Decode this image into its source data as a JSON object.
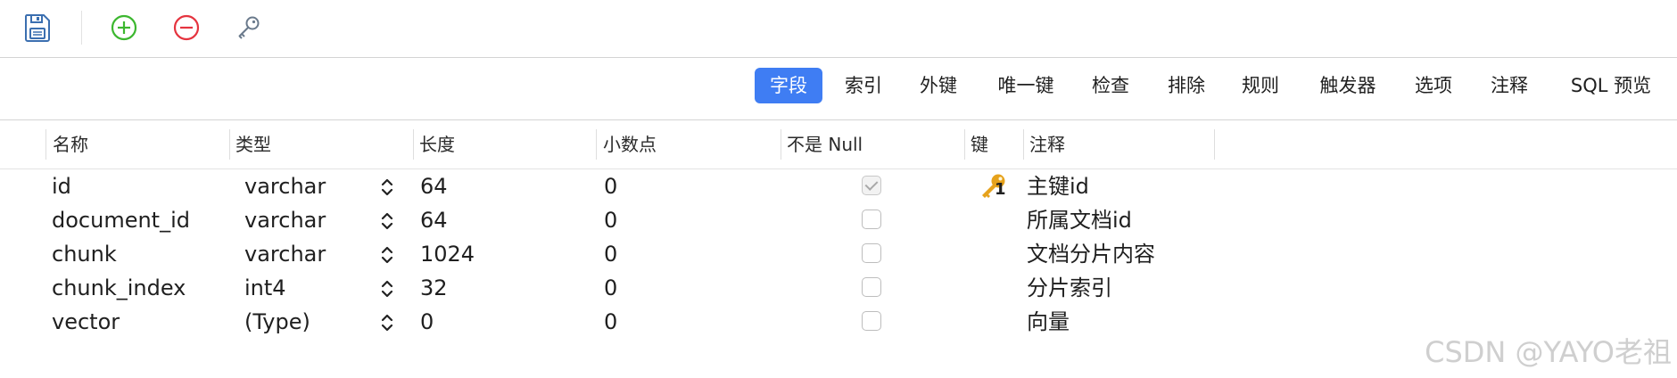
{
  "toolbar": {
    "icons": [
      "save-icon",
      "plus-circle-icon",
      "minus-circle-icon",
      "key-icon"
    ]
  },
  "tabs": [
    {
      "label": "字段",
      "active": true
    },
    {
      "label": "索引"
    },
    {
      "label": "外键"
    },
    {
      "label": "唯一键"
    },
    {
      "label": "检查"
    },
    {
      "label": "排除"
    },
    {
      "label": "规则"
    },
    {
      "label": "触发器"
    },
    {
      "label": "选项"
    },
    {
      "label": "注释"
    },
    {
      "label": "SQL 预览"
    }
  ],
  "columns": [
    "名称",
    "类型",
    "长度",
    "小数点",
    "不是 Null",
    "键",
    "注释"
  ],
  "rows": [
    {
      "name": "id",
      "type": "varchar",
      "length": "64",
      "decimal": "0",
      "not_null": true,
      "key": "1",
      "comment": "主键id"
    },
    {
      "name": "document_id",
      "type": "varchar",
      "length": "64",
      "decimal": "0",
      "not_null": false,
      "key": "",
      "comment": "所属文档id"
    },
    {
      "name": "chunk",
      "type": "varchar",
      "length": "1024",
      "decimal": "0",
      "not_null": false,
      "key": "",
      "comment": "文档分片内容"
    },
    {
      "name": "chunk_index",
      "type": "int4",
      "length": "32",
      "decimal": "0",
      "not_null": false,
      "key": "",
      "comment": "分片索引"
    },
    {
      "name": "vector",
      "type": "(Type)",
      "length": "0",
      "decimal": "0",
      "not_null": false,
      "key": "",
      "comment": "向量"
    }
  ],
  "watermark": "CSDN @YAYO老祖",
  "colors": {
    "accent": "#3f7df3",
    "add": "#3cb72f",
    "remove": "#e5343f"
  }
}
